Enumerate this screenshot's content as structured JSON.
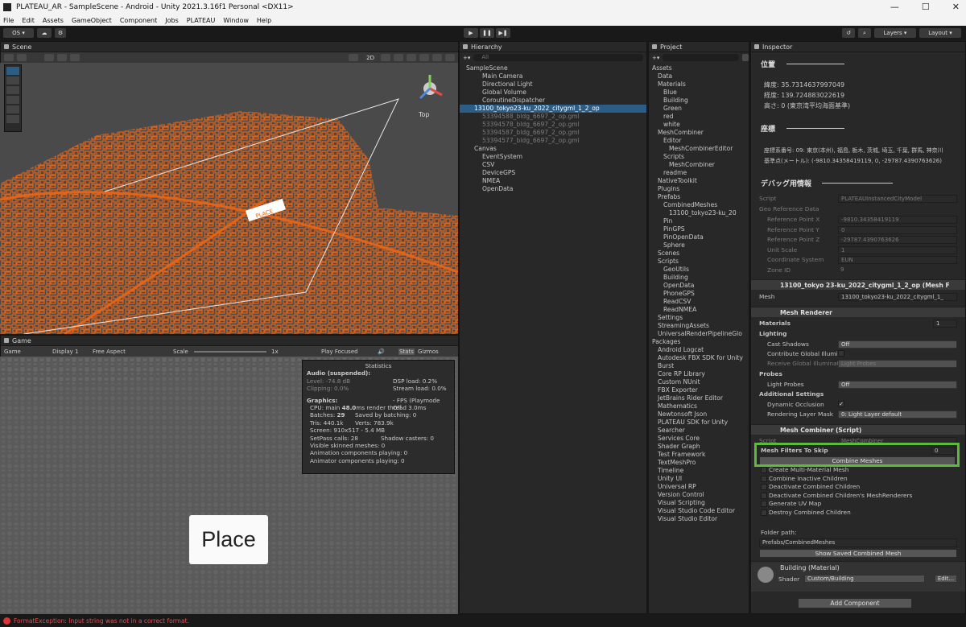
{
  "window": {
    "title": "PLATEAU_AR - SampleScene - Android - Unity 2021.3.16f1 Personal <DX11>"
  },
  "menu": [
    "File",
    "Edit",
    "Assets",
    "GameObject",
    "Component",
    "Jobs",
    "PLATEAU",
    "Window",
    "Help"
  ],
  "toolbar": {
    "account": "OS",
    "layers": "Layers",
    "layout": "Layout"
  },
  "scene": {
    "tab": "Scene",
    "mode2d": "2D",
    "gizmo_label": "Top",
    "place_label": "PLACE"
  },
  "game": {
    "tab": "Game",
    "display_mode": "Game",
    "display": "Display 1",
    "aspect": "Free Aspect",
    "scale_label": "Scale",
    "scale_value": "1x",
    "play_mode": "Play Focused",
    "stats": "Stats",
    "gizmos": "Gizmos",
    "stats_title": "Statistics",
    "audio_title": "Audio (suspended):",
    "level": "Level: -74.8 dB",
    "dsp": "DSP load: 0.2%",
    "clipping": "Clipping: 0.0%",
    "stream": "Stream load: 0.0%",
    "graphics_title": "Graphics:",
    "fps": "- FPS (Playmode Off",
    "cpu_main": "CPU: main",
    "cpu_main_val": "48.0",
    "cpu_rest": "ms  render thread 3.0ms",
    "batches_label": "Batches:",
    "batches": "29",
    "saved": "Saved by batching: 0",
    "tris": "Tris: 440.1k",
    "verts": "Verts: 783.9k",
    "screen": "Screen: 910x517 - 5.4 MB",
    "setpass": "SetPass calls: 28",
    "shadow": "Shadow casters: 0",
    "skinned": "Visible skinned meshes: 0",
    "anim": "Animation components playing: 0",
    "animator": "Animator components playing: 0",
    "place_button": "Place"
  },
  "hierarchy": {
    "tab": "Hierarchy",
    "search": "All",
    "items": [
      {
        "t": "SampleScene",
        "d": 0
      },
      {
        "t": "Main Camera",
        "d": 2
      },
      {
        "t": "Directional Light",
        "d": 2
      },
      {
        "t": "Global Volume",
        "d": 2
      },
      {
        "t": "CoroutineDispatcher",
        "d": 2
      },
      {
        "t": "13100_tokyo23-ku_2022_citygml_1_2_op",
        "d": 1,
        "sel": true
      },
      {
        "t": "53394588_bldg_6697_2_op.gml",
        "d": 2,
        "gray": true
      },
      {
        "t": "53394578_bldg_6697_2_op.gml",
        "d": 2,
        "gray": true
      },
      {
        "t": "53394587_bldg_6697_2_op.gml",
        "d": 2,
        "gray": true
      },
      {
        "t": "53394577_bldg_6697_2_op.gml",
        "d": 2,
        "gray": true
      },
      {
        "t": "Canvas",
        "d": 1
      },
      {
        "t": "EventSystem",
        "d": 2
      },
      {
        "t": "CSV",
        "d": 2
      },
      {
        "t": "DeviceGPS",
        "d": 2
      },
      {
        "t": "NMEA",
        "d": 2
      },
      {
        "t": "OpenData",
        "d": 2
      }
    ]
  },
  "project": {
    "tab": "Project",
    "items": [
      "Assets",
      "Data",
      "Materials",
      "Blue",
      "Building",
      "Green",
      "red",
      "white",
      "MeshCombiner",
      "Editor",
      "MeshCombinerEditor",
      "Scripts",
      "MeshCombiner",
      "readme",
      "NativeToolkit",
      "Plugins",
      "Prefabs",
      "CombinedMeshes",
      "13100_tokyo23-ku_20",
      "Pin",
      "PinGPS",
      "PinOpenData",
      "Sphere",
      "Scenes",
      "Scripts",
      "GeoUtils",
      "Building",
      "OpenData",
      "PhoneGPS",
      "ReadCSV",
      "ReadNMEA",
      "Settings",
      "StreamingAssets",
      "UniversalRenderPipelineGlo",
      "Packages",
      "Android Logcat",
      "Autodesk FBX SDK for Unity",
      "Burst",
      "Core RP Library",
      "Custom NUnit",
      "FBX Exporter",
      "JetBrains Rider Editor",
      "Mathematics",
      "Newtonsoft Json",
      "PLATEAU SDK for Unity",
      "Searcher",
      "Services Core",
      "Shader Graph",
      "Test Framework",
      "TextMeshPro",
      "Timeline",
      "Unity UI",
      "Universal RP",
      "Version Control",
      "Visual Scripting",
      "Visual Studio Code Editor",
      "Visual Studio Editor"
    ],
    "depth": [
      0,
      1,
      1,
      2,
      2,
      2,
      2,
      2,
      1,
      2,
      3,
      2,
      3,
      2,
      1,
      1,
      1,
      2,
      3,
      2,
      2,
      2,
      2,
      1,
      1,
      2,
      2,
      2,
      2,
      2,
      2,
      1,
      1,
      1,
      0,
      1,
      1,
      1,
      1,
      1,
      1,
      1,
      1,
      1,
      1,
      1,
      1,
      1,
      1,
      1,
      1,
      1,
      1,
      1,
      1,
      1,
      1
    ]
  },
  "inspector": {
    "tab": "Inspector",
    "pos_title": "位置",
    "lat": "緯度: 35.7314637997049",
    "lon": "経度: 139.724883022619",
    "alt": "高さ: 0 (東京湾平均海面基準)",
    "coord_title": "座標",
    "coord_sys": "座標系番号: 09: 東京(本州), 福島, 栃木, 茨城, 埼玉, 千葉, 群馬, 神奈川",
    "base_point": "基準点(メートル): (-9810.34358419119, 0, -29787.4390763626)",
    "debug_title": "デバッグ用情報",
    "script_label": "Script",
    "script_val": "PLATEAUInstancedCityModel",
    "geo_label": "Geo Reference Data",
    "refx_label": "Reference Point X",
    "refx": "-9810.34358419119",
    "refy_label": "Reference Point Y",
    "refy": "0",
    "refz_label": "Reference Point Z",
    "refz": "-29787.4390763626",
    "unit_label": "Unit Scale",
    "unit": "1",
    "cs_label": "Coordinate System",
    "cs": "EUN",
    "zone_label": "Zone ID",
    "zone": "9",
    "meshfilter_title": "13100_tokyo 23-ku_2022_citygml_1_2_op (Mesh F",
    "mesh_label": "Mesh",
    "mesh_val": "13100_tokyo23-ku_2022_citygml_1_",
    "renderer_title": "Mesh Renderer",
    "materials_label": "Materials",
    "materials_count": "1",
    "lighting_label": "Lighting",
    "cast_label": "Cast Shadows",
    "cast": "Off",
    "contrib_label": "Contribute Global Illumin",
    "receive_label": "Receive Global Illuminati",
    "receive": "Light Probes",
    "probes_label": "Probes",
    "lightprobes_label": "Light Probes",
    "lightprobes": "Off",
    "addl_label": "Additional Settings",
    "dyn_label": "Dynamic Occlusion",
    "rlm_label": "Rendering Layer Mask",
    "rlm": "0: Light Layer default",
    "combiner_title": "Mesh Combiner (Script)",
    "script2": "MeshCombiner",
    "skip_label": "Mesh Filters To Skip",
    "skip": "0",
    "combine_btn": "Combine Meshes",
    "opts": [
      "Create Multi-Material Mesh",
      "Combine Inactive Children",
      "Deactivate Combined Children",
      "Deactivate Combined Children's MeshRenderers",
      "Generate UV Map",
      "Destroy Combined Children"
    ],
    "folder_label": "Folder path:",
    "folder": "Prefabs/CombinedMeshes",
    "show_btn": "Show Saved Combined Mesh",
    "mat_title": "Building (Material)",
    "shader_label": "Shader",
    "shader": "Custom/Building",
    "edit_btn": "Edit...",
    "add_btn": "Add Component"
  },
  "status": {
    "error": "FormatException: Input string was not in a correct format."
  },
  "colors": {
    "highlight": "#5dbb3b",
    "selection": "#2c5d87",
    "buildings": "#e0651b"
  }
}
